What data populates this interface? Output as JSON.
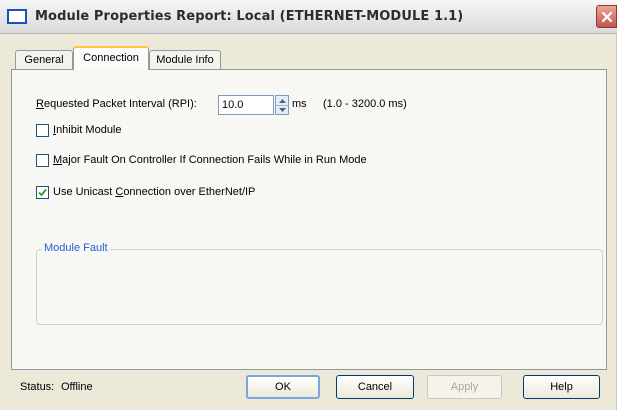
{
  "window": {
    "title": "Module Properties Report: Local (ETHERNET-MODULE 1.1)",
    "icons": {
      "title": "window-icon",
      "close": "close-icon"
    }
  },
  "tabs": [
    {
      "label": "General",
      "active": false
    },
    {
      "label": "Connection",
      "active": true
    },
    {
      "label": "Module Info",
      "active": false
    }
  ],
  "connection": {
    "rpi": {
      "label_accel": "R",
      "label_rest": "equested Packet Interval (RPI):",
      "value": "10.0",
      "units": "ms",
      "range": "(1.0 - 3200.0 ms)"
    },
    "inhibit": {
      "label_accel": "I",
      "label_rest": "nhibit Module",
      "checked": false
    },
    "major_fault": {
      "label_accel": "M",
      "label_rest": "ajor Fault On Controller If Connection Fails While in Run Mode",
      "checked": false
    },
    "unicast": {
      "label_before": "Use Unicast ",
      "label_accel": "C",
      "label_after": "onnection over EtherNet/IP",
      "checked": true
    }
  },
  "module_fault": {
    "title": "Module Fault"
  },
  "status": {
    "label": "Status:",
    "value": "Offline"
  },
  "buttons": {
    "ok": "OK",
    "cancel": "Cancel",
    "apply": "Apply",
    "help": "Help"
  },
  "colors": {
    "group_title": "#2a5dd6",
    "tab_highlight": "#ffc83c",
    "close_button": "#c3564a"
  }
}
